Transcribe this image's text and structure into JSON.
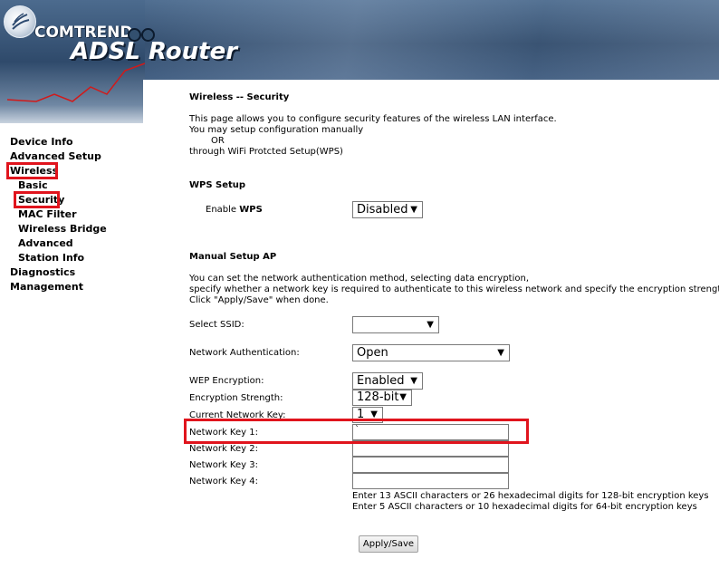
{
  "header": {
    "brand": "COMTREND",
    "product": "ADSL Router"
  },
  "sidebar": {
    "items": [
      {
        "label": "Device Info"
      },
      {
        "label": "Advanced Setup"
      },
      {
        "label": "Wireless"
      },
      {
        "label": "Basic"
      },
      {
        "label": "Security"
      },
      {
        "label": "MAC Filter"
      },
      {
        "label": "Wireless Bridge"
      },
      {
        "label": "Advanced"
      },
      {
        "label": "Station Info"
      },
      {
        "label": "Diagnostics"
      },
      {
        "label": "Management"
      }
    ]
  },
  "main": {
    "title": "Wireless -- Security",
    "intro": [
      "This page allows you to configure security features of the wireless LAN interface.",
      "You may setup configuration manually",
      "OR",
      "through WiFi Protcted Setup(WPS)"
    ],
    "wps": {
      "heading": "WPS Setup",
      "enable_label": "Enable",
      "enable_label_bold": "WPS",
      "value": "Disabled"
    },
    "manual": {
      "heading": "Manual Setup AP",
      "desc": [
        "You can set the network authentication method, selecting data encryption,",
        "specify whether a network key is required to authenticate to this wireless network and specify the encryption strength.",
        "Click \"Apply/Save\" when done."
      ],
      "ssid_label": "Select SSID:",
      "ssid_value": "",
      "auth_label": "Network Authentication:",
      "auth_value": "Open",
      "wep_label": "WEP Encryption:",
      "wep_value": "Enabled",
      "strength_label": "Encryption Strength:",
      "strength_value": "128-bit",
      "current_key_label": "Current Network Key:",
      "current_key_value": "1",
      "key1_label": "Network Key 1:",
      "key1_value": "`",
      "key2_label": "Network Key 2:",
      "key3_label": "Network Key 3:",
      "key4_label": "Network Key 4:",
      "hint1": "Enter 13 ASCII characters or 26 hexadecimal digits for 128-bit encryption keys",
      "hint2": "Enter 5 ASCII characters or 10 hexadecimal digits for 64-bit encryption keys",
      "apply_label": "Apply/Save"
    }
  },
  "colors": {
    "highlight": "#e0141d",
    "banner": "#2f4a6b",
    "divider": "#b30000"
  }
}
